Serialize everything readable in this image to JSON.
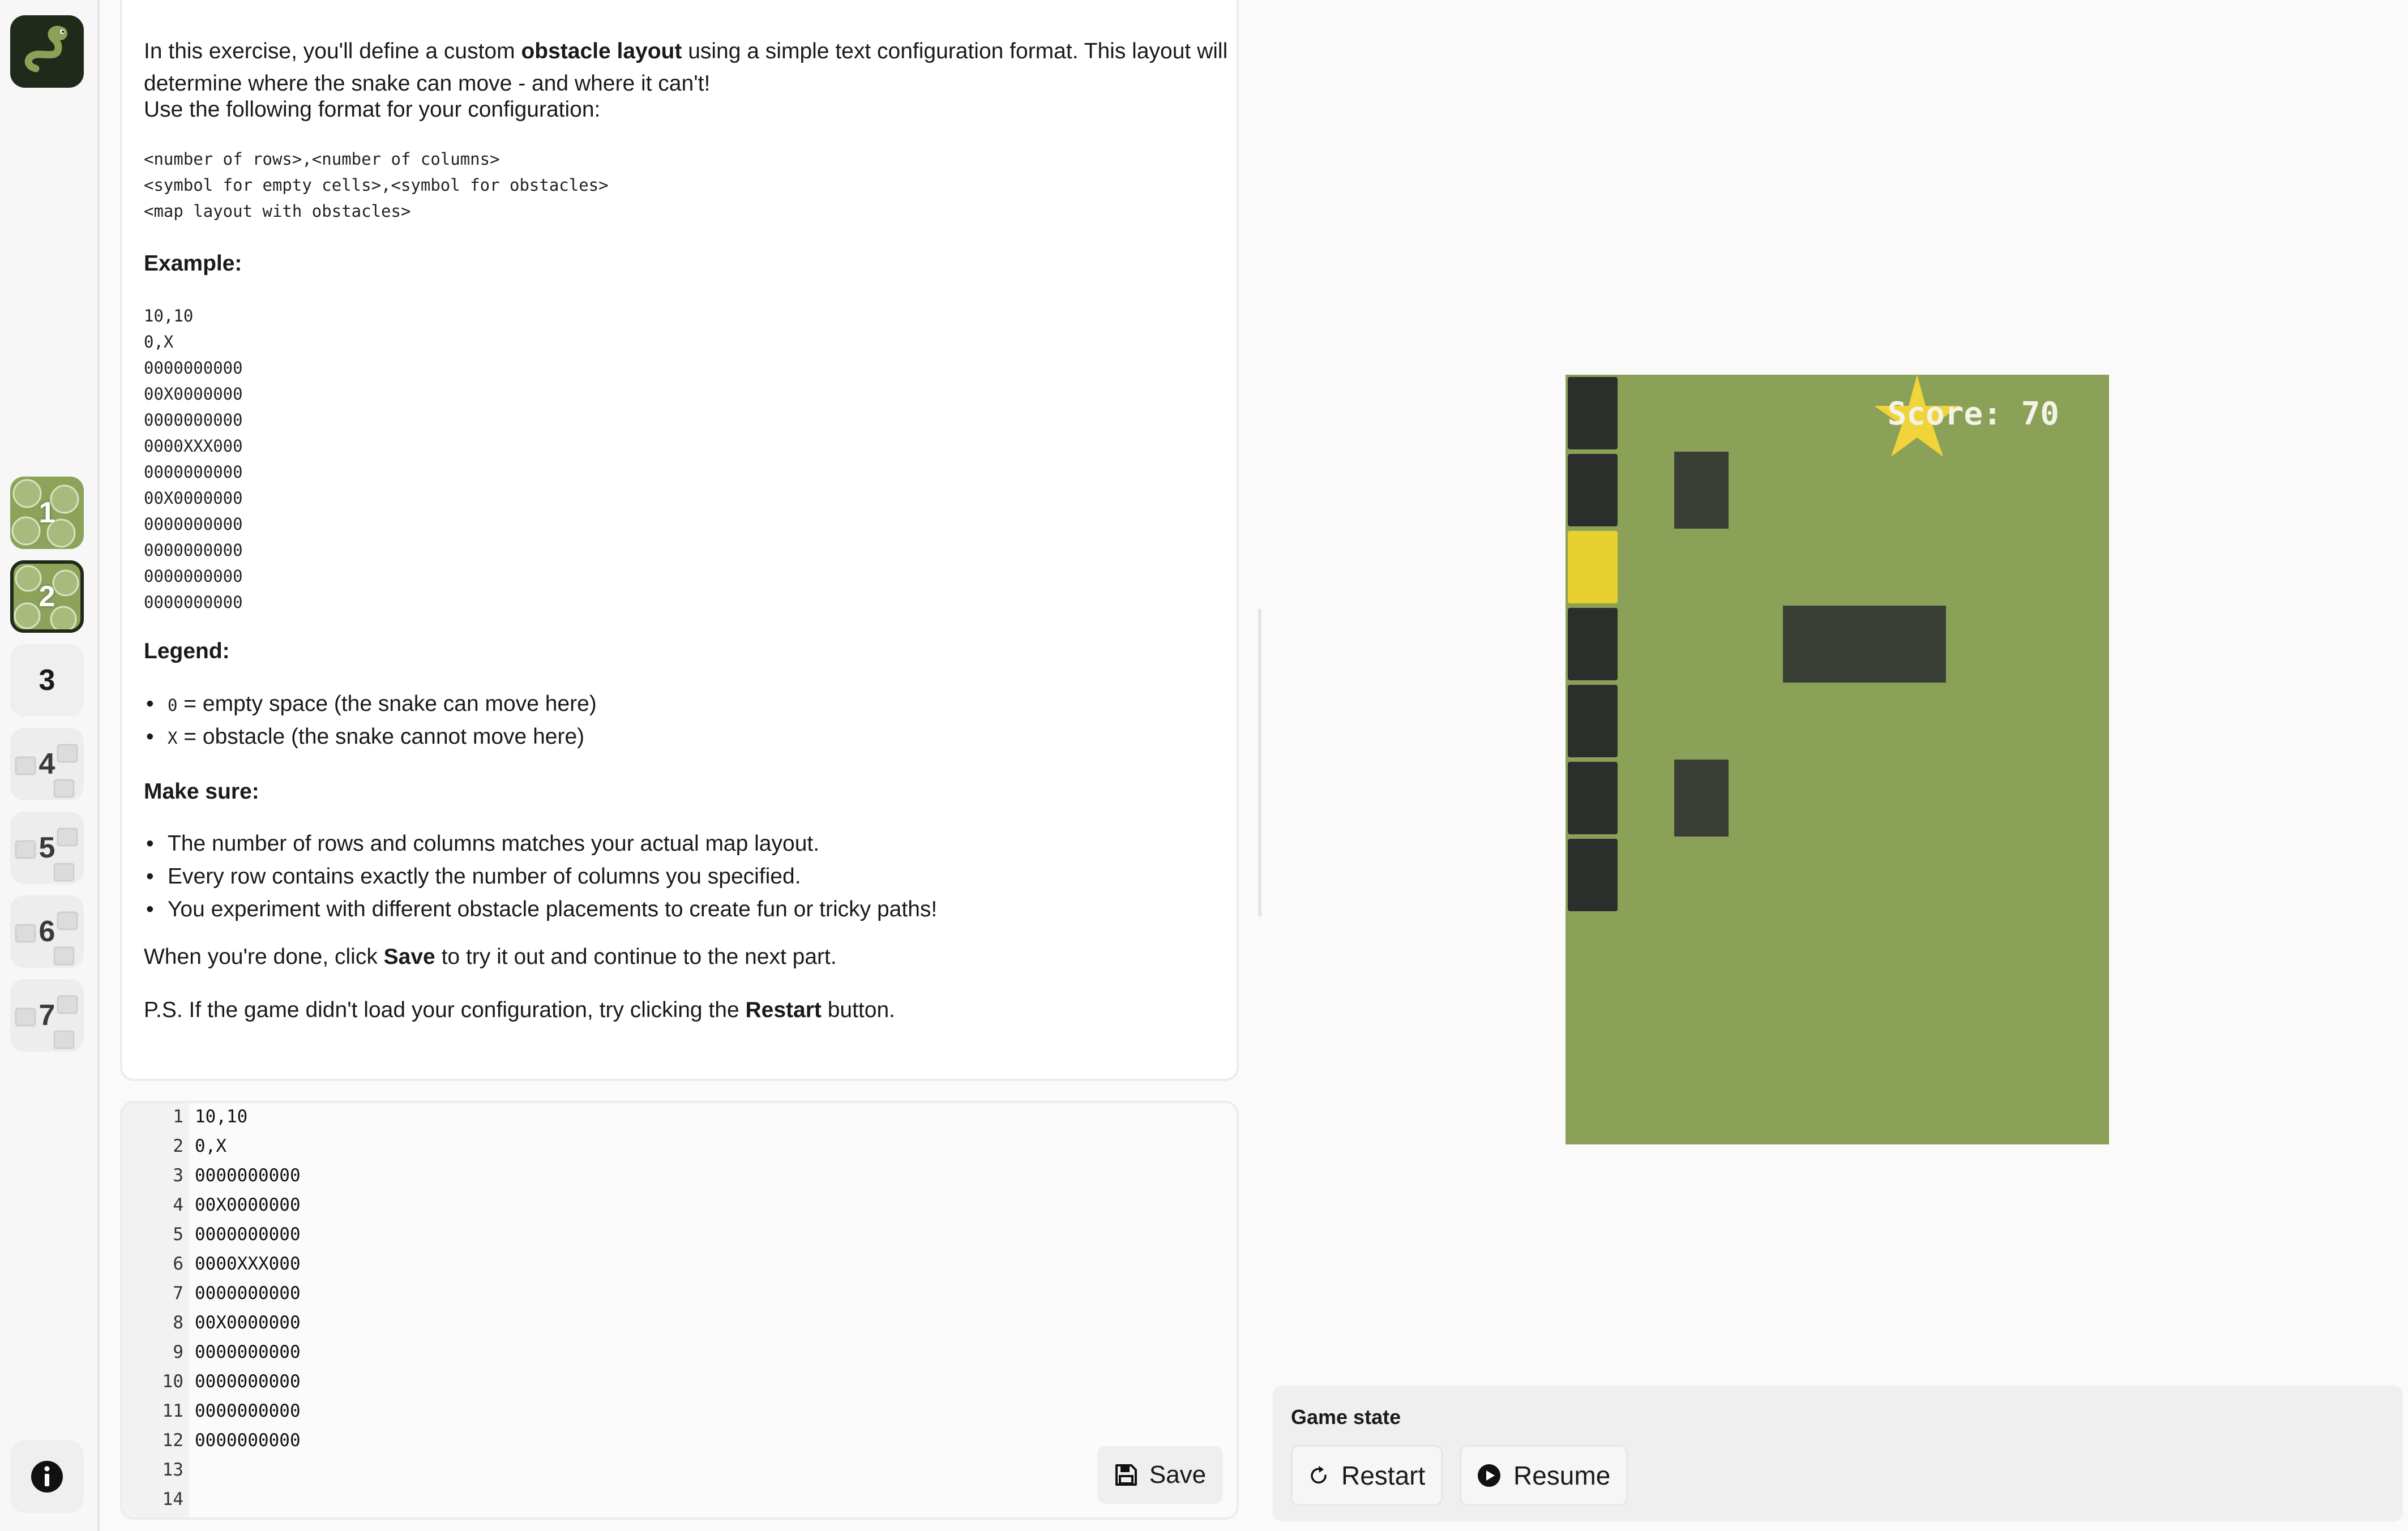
{
  "sidebar": {
    "levels": [
      {
        "label": "1",
        "status": "completed"
      },
      {
        "label": "2",
        "status": "completed-current"
      },
      {
        "label": "3",
        "status": "available"
      },
      {
        "label": "4",
        "status": "locked"
      },
      {
        "label": "5",
        "status": "locked"
      },
      {
        "label": "6",
        "status": "locked"
      },
      {
        "label": "7",
        "status": "locked"
      }
    ]
  },
  "instructions": {
    "intro_before": "In this exercise, you'll define a custom ",
    "intro_bold": "obstacle layout",
    "intro_after": " using a simple text configuration format. This layout will",
    "intro_line2": "determine where the snake can move - and where it can't!",
    "format_intro": "Use the following format for your configuration:",
    "format_lines": [
      "<number of rows>,<number of columns>",
      "<symbol for empty cells>,<symbol for obstacles>",
      "<map layout with obstacles>"
    ],
    "example_heading": "Example:",
    "example_lines": [
      "10,10",
      "0,X",
      "0000000000",
      "00X0000000",
      "0000000000",
      "0000XXX000",
      "0000000000",
      "00X0000000",
      "0000000000",
      "0000000000",
      "0000000000",
      "0000000000"
    ],
    "legend_heading": "Legend:",
    "legend_items": [
      {
        "code": "0",
        "text": " = empty space (the snake can move here)"
      },
      {
        "code": "X",
        "text": " = obstacle (the snake cannot move here)"
      }
    ],
    "makesure_heading": "Make sure:",
    "makesure_items": [
      "The number of rows and columns matches your actual map layout.",
      "Every row contains exactly the number of columns you specified.",
      "You experiment with different obstacle placements to create fun or tricky paths!"
    ],
    "done_before": "When you're done, click ",
    "done_bold": "Save",
    "done_after": " to try it out and continue to the next part.",
    "ps_before": "P.S. If the game didn't load your configuration, try clicking the ",
    "ps_bold": "Restart",
    "ps_after": " button."
  },
  "editor": {
    "line_numbers": [
      "1",
      "2",
      "3",
      "4",
      "5",
      "6",
      "7",
      "8",
      "9",
      "10",
      "11",
      "12",
      "13",
      "14"
    ],
    "lines": [
      "10,10",
      "0,X",
      "0000000000",
      "00X0000000",
      "0000000000",
      "0000XXX000",
      "0000000000",
      "00X0000000",
      "0000000000",
      "0000000000",
      "0000000000",
      "0000000000",
      "",
      ""
    ],
    "save_label": "Save"
  },
  "game": {
    "score_text": "Score: 70",
    "board_color": "#8ca158",
    "obstacle_color": "#3a3f35",
    "snake_color": "#2c2e2b",
    "food_color": "#e8d12e",
    "star_color": "#f0d43a"
  },
  "game_state": {
    "title": "Game state",
    "restart_label": "Restart",
    "resume_label": "Resume"
  }
}
